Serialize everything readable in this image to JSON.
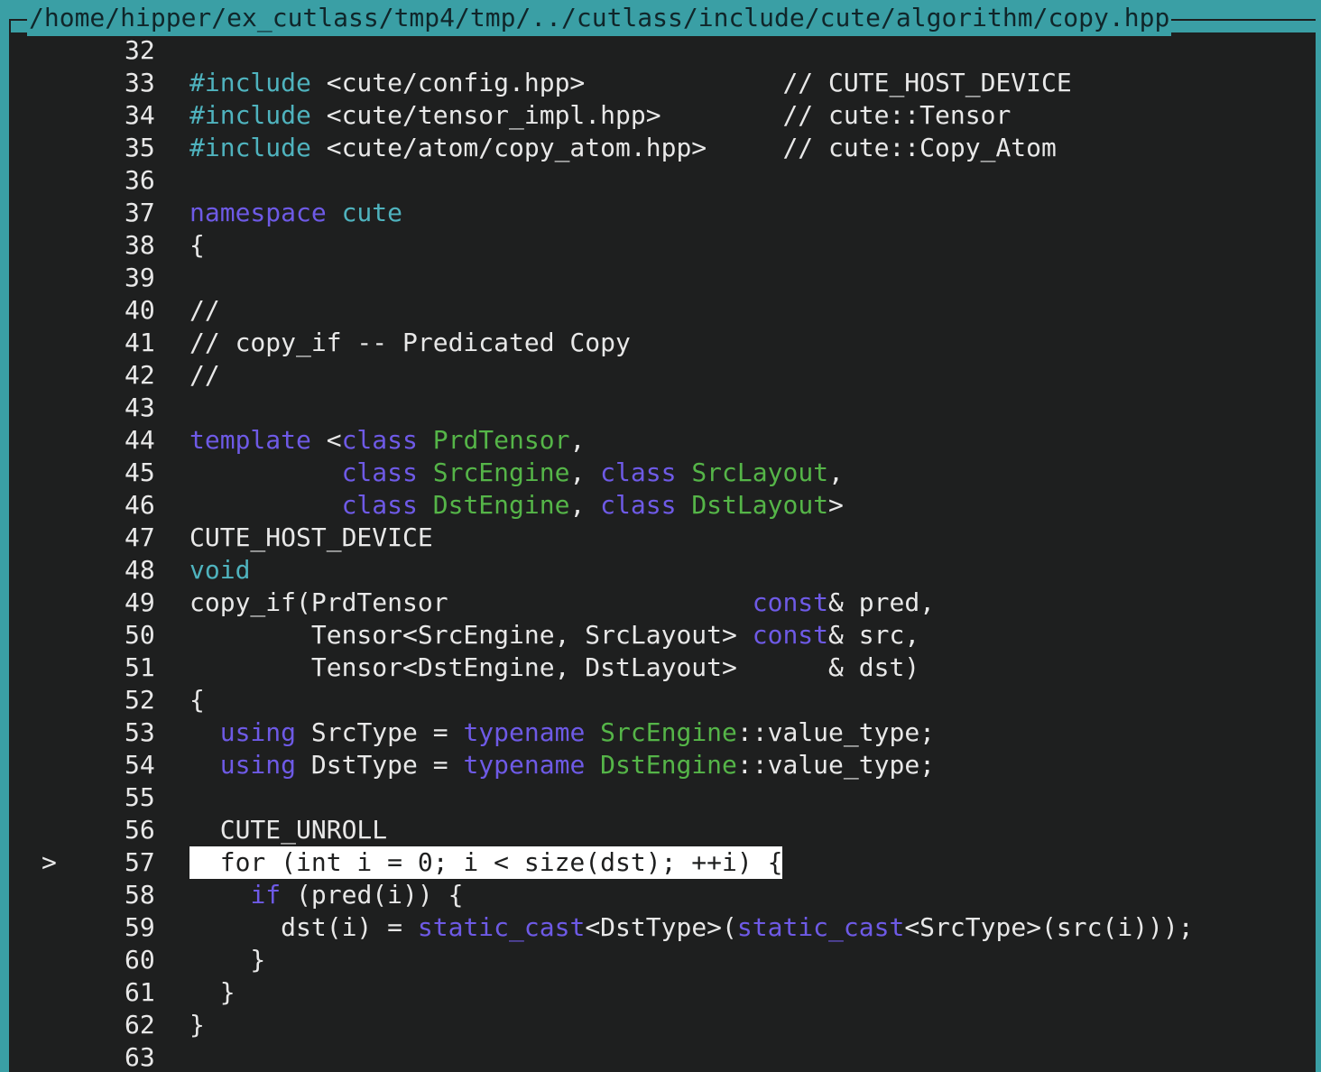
{
  "window": {
    "title": "/home/hipper/ex_cutlass/tmp4/tmp/../cutlass/include/cute/algorithm/copy.hpp"
  },
  "colors": {
    "frame": "#3a9fa5",
    "background": "#1e1f1f",
    "text": "#e8e8e8",
    "keyword": "#6e5ae6",
    "preproc_type": "#4fb3be",
    "type_name": "#55b548",
    "highlight_bg": "#ffffff"
  },
  "current_line_marker": ">",
  "lines": [
    {
      "no": "32",
      "current": false,
      "segments": []
    },
    {
      "no": "33",
      "current": false,
      "segments": [
        {
          "t": "#include",
          "c": "c"
        },
        {
          "t": " <cute/config.hpp>             // CUTE_HOST_DEVICE",
          "c": "d"
        }
      ]
    },
    {
      "no": "34",
      "current": false,
      "segments": [
        {
          "t": "#include",
          "c": "c"
        },
        {
          "t": " <cute/tensor_impl.hpp>        // cute::Tensor",
          "c": "d"
        }
      ]
    },
    {
      "no": "35",
      "current": false,
      "segments": [
        {
          "t": "#include",
          "c": "c"
        },
        {
          "t": " <cute/atom/copy_atom.hpp>     // cute::Copy_Atom",
          "c": "d"
        }
      ]
    },
    {
      "no": "36",
      "current": false,
      "segments": []
    },
    {
      "no": "37",
      "current": false,
      "segments": [
        {
          "t": "namespace",
          "c": "k"
        },
        {
          "t": " ",
          "c": "d"
        },
        {
          "t": "cute",
          "c": "c"
        }
      ]
    },
    {
      "no": "38",
      "current": false,
      "segments": [
        {
          "t": "{",
          "c": "d"
        }
      ]
    },
    {
      "no": "39",
      "current": false,
      "segments": []
    },
    {
      "no": "40",
      "current": false,
      "segments": [
        {
          "t": "//",
          "c": "d"
        }
      ]
    },
    {
      "no": "41",
      "current": false,
      "segments": [
        {
          "t": "// copy_if -- Predicated Copy",
          "c": "d"
        }
      ]
    },
    {
      "no": "42",
      "current": false,
      "segments": [
        {
          "t": "//",
          "c": "d"
        }
      ]
    },
    {
      "no": "43",
      "current": false,
      "segments": []
    },
    {
      "no": "44",
      "current": false,
      "segments": [
        {
          "t": "template",
          "c": "k"
        },
        {
          "t": " <",
          "c": "d"
        },
        {
          "t": "class",
          "c": "k"
        },
        {
          "t": " ",
          "c": "d"
        },
        {
          "t": "PrdTensor",
          "c": "g"
        },
        {
          "t": ",",
          "c": "d"
        }
      ]
    },
    {
      "no": "45",
      "current": false,
      "segments": [
        {
          "t": "          ",
          "c": "d"
        },
        {
          "t": "class",
          "c": "k"
        },
        {
          "t": " ",
          "c": "d"
        },
        {
          "t": "SrcEngine",
          "c": "g"
        },
        {
          "t": ", ",
          "c": "d"
        },
        {
          "t": "class",
          "c": "k"
        },
        {
          "t": " ",
          "c": "d"
        },
        {
          "t": "SrcLayout",
          "c": "g"
        },
        {
          "t": ",",
          "c": "d"
        }
      ]
    },
    {
      "no": "46",
      "current": false,
      "segments": [
        {
          "t": "          ",
          "c": "d"
        },
        {
          "t": "class",
          "c": "k"
        },
        {
          "t": " ",
          "c": "d"
        },
        {
          "t": "DstEngine",
          "c": "g"
        },
        {
          "t": ", ",
          "c": "d"
        },
        {
          "t": "class",
          "c": "k"
        },
        {
          "t": " ",
          "c": "d"
        },
        {
          "t": "DstLayout",
          "c": "g"
        },
        {
          "t": ">",
          "c": "d"
        }
      ]
    },
    {
      "no": "47",
      "current": false,
      "segments": [
        {
          "t": "CUTE_HOST_DEVICE",
          "c": "d"
        }
      ]
    },
    {
      "no": "48",
      "current": false,
      "segments": [
        {
          "t": "void",
          "c": "c"
        }
      ]
    },
    {
      "no": "49",
      "current": false,
      "segments": [
        {
          "t": "copy_if(PrdTensor                    ",
          "c": "d"
        },
        {
          "t": "const",
          "c": "k"
        },
        {
          "t": "& pred,",
          "c": "d"
        }
      ]
    },
    {
      "no": "50",
      "current": false,
      "segments": [
        {
          "t": "        Tensor<SrcEngine, SrcLayout> ",
          "c": "d"
        },
        {
          "t": "const",
          "c": "k"
        },
        {
          "t": "& src,",
          "c": "d"
        }
      ]
    },
    {
      "no": "51",
      "current": false,
      "segments": [
        {
          "t": "        Tensor<DstEngine, DstLayout>      & dst)",
          "c": "d"
        }
      ]
    },
    {
      "no": "52",
      "current": false,
      "segments": [
        {
          "t": "{",
          "c": "d"
        }
      ]
    },
    {
      "no": "53",
      "current": false,
      "segments": [
        {
          "t": "  ",
          "c": "d"
        },
        {
          "t": "using",
          "c": "k"
        },
        {
          "t": " SrcType = ",
          "c": "d"
        },
        {
          "t": "typename",
          "c": "k"
        },
        {
          "t": " ",
          "c": "d"
        },
        {
          "t": "SrcEngine",
          "c": "g"
        },
        {
          "t": "::value_type;",
          "c": "d"
        }
      ]
    },
    {
      "no": "54",
      "current": false,
      "segments": [
        {
          "t": "  ",
          "c": "d"
        },
        {
          "t": "using",
          "c": "k"
        },
        {
          "t": " DstType = ",
          "c": "d"
        },
        {
          "t": "typename",
          "c": "k"
        },
        {
          "t": " ",
          "c": "d"
        },
        {
          "t": "DstEngine",
          "c": "g"
        },
        {
          "t": "::value_type;",
          "c": "d"
        }
      ]
    },
    {
      "no": "55",
      "current": false,
      "segments": []
    },
    {
      "no": "56",
      "current": false,
      "segments": [
        {
          "t": "  CUTE_UNROLL",
          "c": "d"
        }
      ]
    },
    {
      "no": "57",
      "current": true,
      "segments": [
        {
          "t": "  for (int i = 0; i < size(dst); ++i) {",
          "c": "d"
        }
      ]
    },
    {
      "no": "58",
      "current": false,
      "segments": [
        {
          "t": "    ",
          "c": "d"
        },
        {
          "t": "if",
          "c": "k"
        },
        {
          "t": " (pred(i)) {",
          "c": "d"
        }
      ]
    },
    {
      "no": "59",
      "current": false,
      "segments": [
        {
          "t": "      dst(i) = ",
          "c": "d"
        },
        {
          "t": "static_cast",
          "c": "k"
        },
        {
          "t": "<DstType>(",
          "c": "d"
        },
        {
          "t": "static_cast",
          "c": "k"
        },
        {
          "t": "<SrcType>(src(i)));",
          "c": "d"
        }
      ]
    },
    {
      "no": "60",
      "current": false,
      "segments": [
        {
          "t": "    }",
          "c": "d"
        }
      ]
    },
    {
      "no": "61",
      "current": false,
      "segments": [
        {
          "t": "  }",
          "c": "d"
        }
      ]
    },
    {
      "no": "62",
      "current": false,
      "segments": [
        {
          "t": "}",
          "c": "d"
        }
      ]
    },
    {
      "no": "63",
      "current": false,
      "segments": []
    }
  ]
}
